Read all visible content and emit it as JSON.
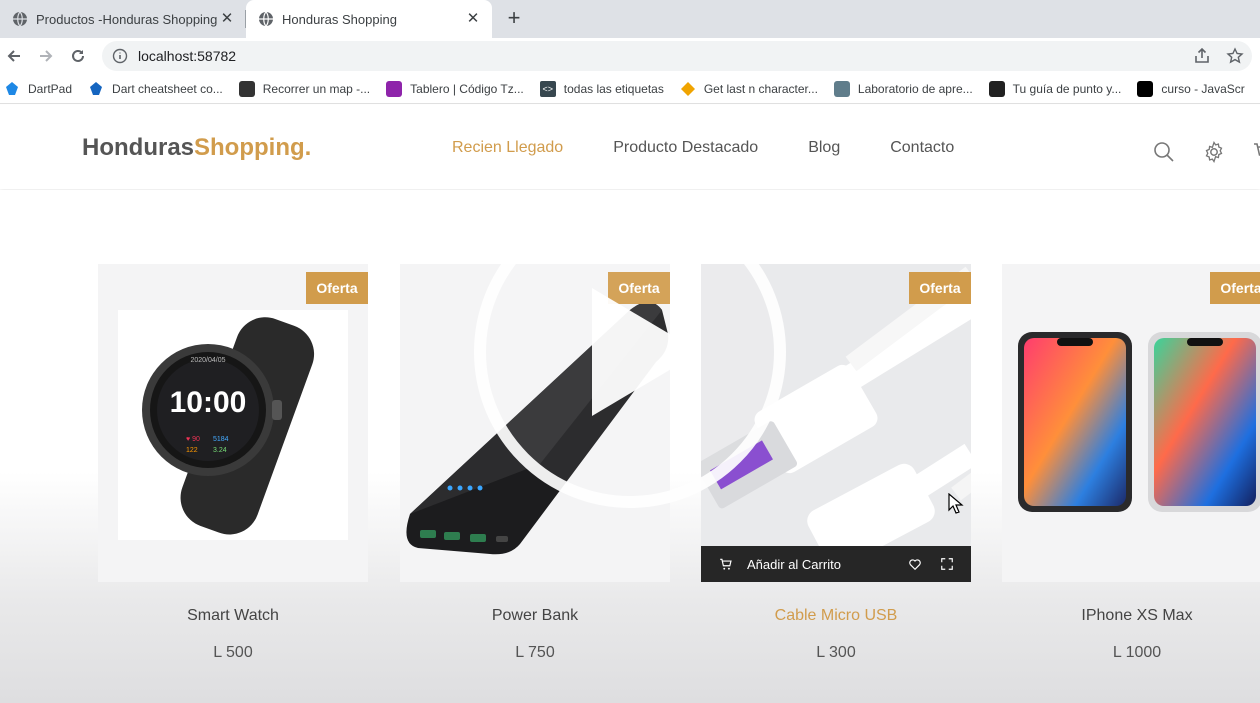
{
  "browser": {
    "tabs": [
      {
        "title": "Productos -Honduras Shopping!",
        "active": false
      },
      {
        "title": "Honduras Shopping",
        "active": true
      }
    ],
    "url": "localhost:58782",
    "bookmarks": [
      {
        "label": "DartPad",
        "icon": "dart-icon",
        "color": "#1e88e5"
      },
      {
        "label": "Dart cheatsheet co...",
        "icon": "dart-icon",
        "color": "#1565c0"
      },
      {
        "label": "Recorrer un map -...",
        "icon": "site-icon",
        "color": "#333333"
      },
      {
        "label": "Tablero | Código Tz...",
        "icon": "site-icon",
        "color": "#8e24aa"
      },
      {
        "label": "todas las etiquetas",
        "icon": "code-icon",
        "color": "#37474f"
      },
      {
        "label": "Get last n character...",
        "icon": "diamond-icon",
        "color": "#f0a400"
      },
      {
        "label": "Laboratorio de apre...",
        "icon": "site-icon",
        "color": "#607d8b"
      },
      {
        "label": "Tu guía de punto y...",
        "icon": "site-icon",
        "color": "#212121"
      },
      {
        "label": "curso - JavaScr",
        "icon": "site-icon",
        "color": "#000000"
      }
    ]
  },
  "site": {
    "logo_part1": "Honduras",
    "logo_part2": "Shopping",
    "logo_dot": ".",
    "nav": [
      "Recien Llegado",
      "Producto Destacado",
      "Blog",
      "Contacto"
    ],
    "accent": "#d19c4c"
  },
  "products": [
    {
      "name": "Smart Watch",
      "price": "L 500",
      "badge": "Oferta"
    },
    {
      "name": "Power Bank",
      "price": "L 750",
      "badge": "Oferta"
    },
    {
      "name": "Cable Micro USB",
      "price": "L 300",
      "badge": "Oferta",
      "hover_action": "Añadir al Carrito"
    },
    {
      "name": "IPhone XS Max",
      "price": "L 1000",
      "badge": "Oferta"
    }
  ],
  "watch_face": {
    "time": "10:00"
  }
}
